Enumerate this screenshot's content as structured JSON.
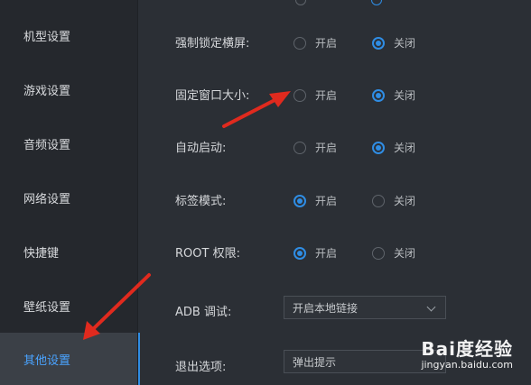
{
  "sidebar": {
    "items": [
      {
        "label": "机型设置"
      },
      {
        "label": "游戏设置"
      },
      {
        "label": "音频设置"
      },
      {
        "label": "网络设置"
      },
      {
        "label": "快捷键"
      },
      {
        "label": "壁纸设置"
      },
      {
        "label": "其他设置",
        "active": true
      }
    ]
  },
  "settings": {
    "force_landscape": {
      "label": "强制锁定横屏:",
      "on": "开启",
      "off": "关闭",
      "selected": "off"
    },
    "fixed_window": {
      "label": "固定窗口大小:",
      "on": "开启",
      "off": "关闭",
      "selected": "off"
    },
    "autostart": {
      "label": "自动启动:",
      "on": "开启",
      "off": "关闭",
      "selected": "off"
    },
    "tab_mode": {
      "label": "标签模式:",
      "on": "开启",
      "off": "关闭",
      "selected": "on"
    },
    "root": {
      "label": "ROOT 权限:",
      "on": "开启",
      "off": "关闭",
      "selected": "on"
    },
    "adb": {
      "label": "ADB 调试:",
      "value": "开启本地链接"
    },
    "exit": {
      "label": "退出选项:",
      "value": "弹出提示"
    }
  },
  "watermark": {
    "brand": "Bai度经验",
    "url": "jingyan.baidu.com"
  },
  "colors": {
    "accent": "#2f8de4",
    "arrow": "#e02a1e",
    "background": "#2b2f35",
    "sidebar": "#25282d"
  }
}
